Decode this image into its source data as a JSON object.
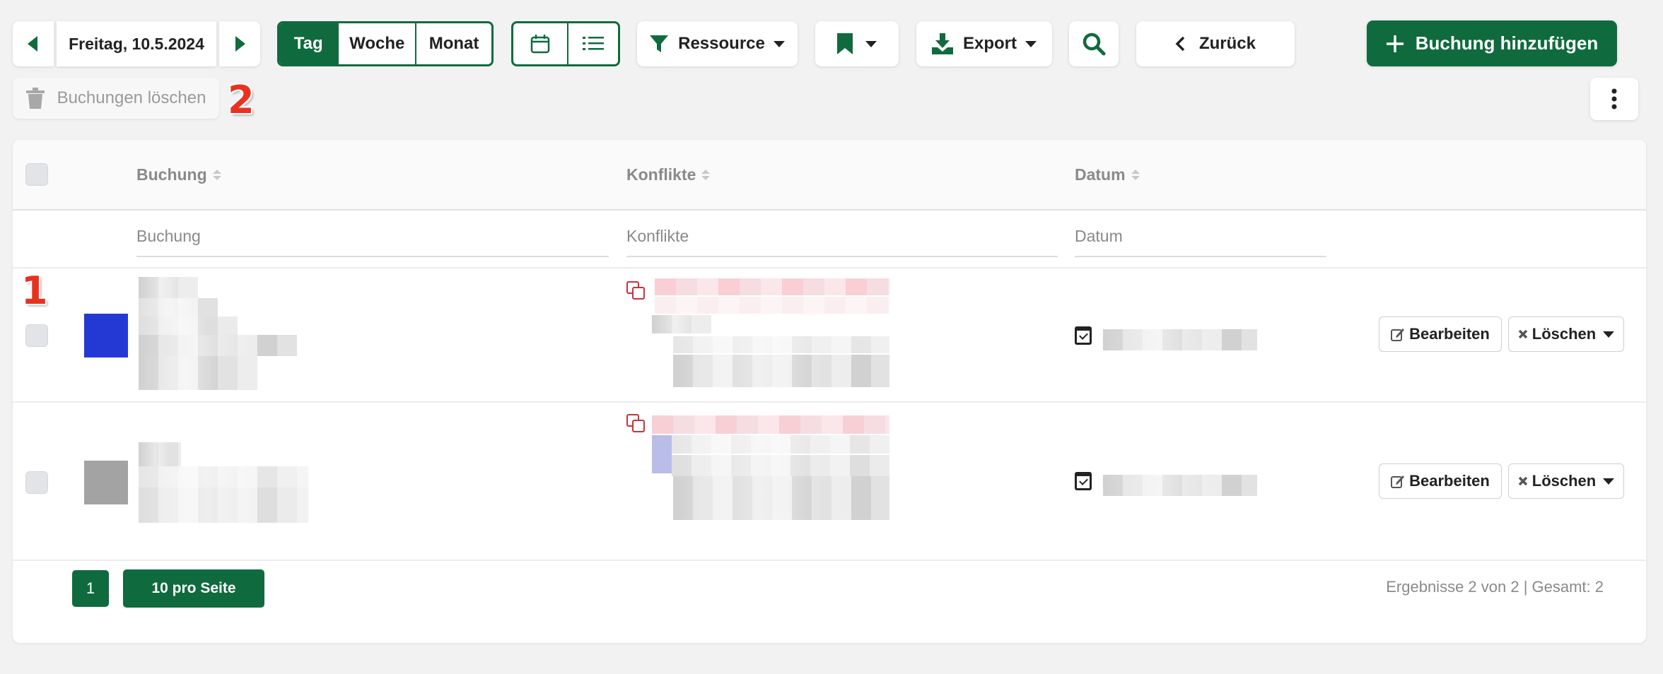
{
  "toolbar": {
    "date_label": "Freitag, 10.5.2024",
    "view_tabs": [
      {
        "label": "Tag",
        "active": true
      },
      {
        "label": "Woche",
        "active": false
      },
      {
        "label": "Monat",
        "active": false
      }
    ],
    "resource_label": "Ressource",
    "export_label": "Export",
    "back_label": "Zurück",
    "add_booking_label": "Buchung hinzufügen",
    "delete_bookings_label": "Buchungen löschen"
  },
  "annotations": {
    "one": "1",
    "two": "2"
  },
  "table": {
    "columns": {
      "booking": "Buchung",
      "conflicts": "Konflikte",
      "date": "Datum"
    },
    "filters": {
      "booking": "Buchung",
      "conflicts": "Konflikte",
      "date": "Datum"
    },
    "rows": [
      {
        "swatch_color": "#2439d3",
        "edit_label": "Bearbeiten",
        "delete_label": "Löschen"
      },
      {
        "swatch_color": "#a3a3a3",
        "edit_label": "Bearbeiten",
        "delete_label": "Löschen"
      }
    ]
  },
  "pagination": {
    "page": "1",
    "per_page_label": "10 pro Seite",
    "results_text": "Ergebnisse 2 von 2 | Gesamt: 2"
  },
  "colors": {
    "brand_green": "#0f6b3e",
    "conflict_red": "#c8323d"
  }
}
